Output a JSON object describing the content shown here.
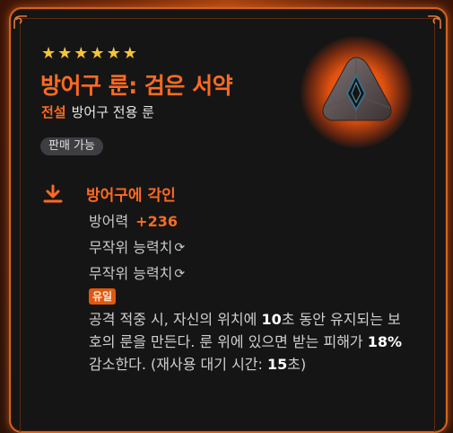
{
  "item": {
    "stars": 6,
    "name": "방어구 룬: 검은 서약",
    "grade": "전설",
    "type": "방어구 전용 룬",
    "sellable": "판매 가능"
  },
  "engrave": {
    "title": "방어구에 각인",
    "defense_label": "방어력",
    "defense_value": "+236",
    "random_stat_1": "무작위 능력치",
    "random_stat_2": "무작위 능력치",
    "unique_tag": "유일",
    "desc_1": "공격 적중 시, 자신의 위치에 ",
    "desc_num1": "10",
    "desc_2": "초 동안 유지되는 보호의 룬을 만든다. 룬 위에 있으면 받는 피해가 ",
    "desc_num2": "18%",
    "desc_3": " 감소한다. (재사용 대기 시간: ",
    "desc_num3": "15",
    "desc_4": "초)"
  },
  "colors": {
    "accent": "#ff6a21",
    "star": "#f3c53a",
    "background": "#151515",
    "border": "#d4631b"
  },
  "icons": {
    "star": "star-icon",
    "download": "download-icon",
    "refresh": "refresh-icon",
    "gem": "rune-gem-icon"
  }
}
